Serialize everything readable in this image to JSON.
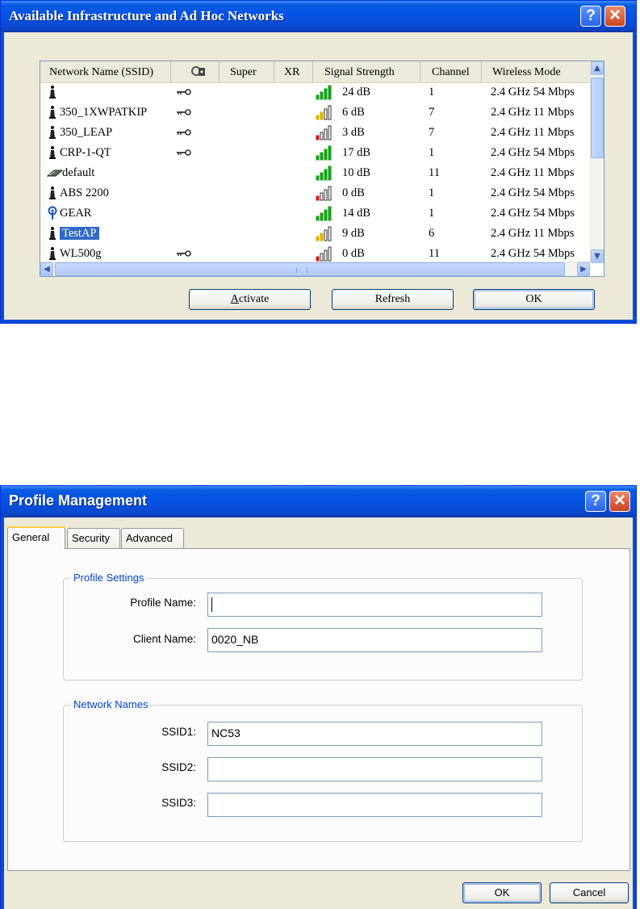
{
  "networks_dialog": {
    "title": "Available Infrastructure and Ad Hoc Networks",
    "columns": [
      "Network Name (SSID)",
      "",
      "Super",
      "XR",
      "Signal Strength",
      "Channel",
      "Wireless Mode"
    ],
    "encryption_column_icon": "key-lock-icon",
    "rows": [
      {
        "ssid": "",
        "type": "infrastructure-icon",
        "encrypted": true,
        "signal": "24 dB",
        "signal_color": "#17a01b",
        "channel": "1",
        "mode": "2.4 GHz 54 Mbps"
      },
      {
        "ssid": "350_1XWPATKIP",
        "type": "infrastructure-icon",
        "encrypted": true,
        "signal": "6 dB",
        "signal_color": "#d8b200",
        "channel": "7",
        "mode": "2.4 GHz 11 Mbps"
      },
      {
        "ssid": "350_LEAP",
        "type": "infrastructure-icon",
        "encrypted": true,
        "signal": "3 dB",
        "signal_color": "#cc1d1d",
        "channel": "7",
        "mode": "2.4 GHz 11 Mbps"
      },
      {
        "ssid": "CRP-1-QT",
        "type": "infrastructure-icon",
        "encrypted": true,
        "signal": "17 dB",
        "signal_color": "#17a01b",
        "channel": "1",
        "mode": "2.4 GHz 54 Mbps"
      },
      {
        "ssid": "default",
        "type": "adhoc-icon",
        "encrypted": false,
        "signal": "10 dB",
        "signal_color": "#17a01b",
        "channel": "11",
        "mode": "2.4 GHz 11 Mbps"
      },
      {
        "ssid": "ABS 2200",
        "type": "infrastructure-icon",
        "encrypted": false,
        "signal": "0 dB",
        "signal_color": "#cc1d1d",
        "channel": "1",
        "mode": "2.4 GHz 54 Mbps"
      },
      {
        "ssid": "GEAR",
        "type": "antenna-icon",
        "encrypted": false,
        "signal": "14 dB",
        "signal_color": "#17a01b",
        "channel": "1",
        "mode": "2.4 GHz 54 Mbps"
      },
      {
        "ssid": "TestAP",
        "type": "infrastructure-icon",
        "encrypted": false,
        "signal": "9 dB",
        "signal_color": "#d8b200",
        "channel": "6",
        "mode": "2.4 GHz 11 Mbps",
        "selected": true
      },
      {
        "ssid": "WL500g",
        "type": "infrastructure-icon",
        "encrypted": true,
        "signal": "0 dB",
        "signal_color": "#cc1d1d",
        "channel": "11",
        "mode": "2.4 GHz 54 Mbps"
      }
    ],
    "buttons": {
      "activate": "Activate",
      "activate_accel": "A",
      "activate_rest": "ctivate",
      "refresh": "Refresh",
      "ok": "OK"
    }
  },
  "profile_dialog": {
    "title": "Profile Management",
    "tabs": [
      "General",
      "Security",
      "Advanced"
    ],
    "active_tab": "General",
    "profile_settings": {
      "legend": "Profile Settings",
      "profile_name_label": "Profile Name:",
      "profile_name_value": "",
      "client_name_label": "Client Name:",
      "client_name_value": "0020_NB"
    },
    "network_names": {
      "legend": "Network Names",
      "ssid1_label": "SSID1:",
      "ssid1_value": "NC53",
      "ssid2_label": "SSID2:",
      "ssid2_value": "",
      "ssid3_label": "SSID3:",
      "ssid3_value": ""
    },
    "buttons": {
      "ok": "OK",
      "cancel": "Cancel"
    }
  }
}
